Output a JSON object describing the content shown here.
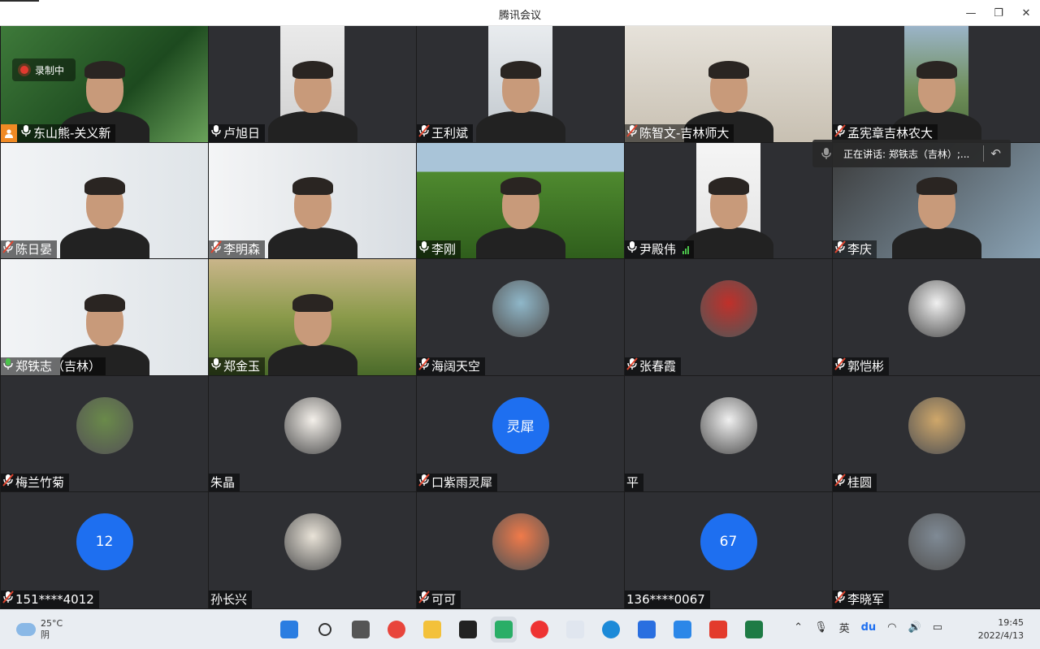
{
  "window": {
    "title": "腾讯会议",
    "controls": [
      "minimize",
      "restore",
      "close"
    ]
  },
  "recording": {
    "label": "录制中"
  },
  "speaking": {
    "text": "正在讲话: 郑铁志（吉林）;..."
  },
  "participants": [
    {
      "name": "东山熊-关义新",
      "mic": "on",
      "host": true,
      "media": "video"
    },
    {
      "name": "卢旭日",
      "mic": "on",
      "media": "video"
    },
    {
      "name": "王利斌",
      "mic": "muted",
      "media": "video"
    },
    {
      "name": "陈智文-吉林师大",
      "mic": "muted",
      "media": "video"
    },
    {
      "name": "孟宪章吉林农大",
      "mic": "muted",
      "media": "video"
    },
    {
      "name": "陈日晏",
      "mic": "muted",
      "media": "video"
    },
    {
      "name": "李明森",
      "mic": "muted",
      "media": "video"
    },
    {
      "name": "李刚",
      "mic": "on",
      "media": "video"
    },
    {
      "name": "尹殿伟",
      "mic": "on",
      "media": "video",
      "signal": true
    },
    {
      "name": "李庆",
      "mic": "muted",
      "media": "video"
    },
    {
      "name": "郑铁志（吉林）",
      "mic": "speaking",
      "media": "video"
    },
    {
      "name": "郑金玉",
      "mic": "on",
      "media": "video"
    },
    {
      "name": "海阔天空",
      "mic": "muted",
      "media": "avatar"
    },
    {
      "name": "张春霞",
      "mic": "muted",
      "media": "avatar"
    },
    {
      "name": "郭恺彬",
      "mic": "muted",
      "media": "avatar"
    },
    {
      "name": "梅兰竹菊",
      "mic": "muted",
      "media": "avatar"
    },
    {
      "name": "朱晶",
      "mic": "none",
      "media": "avatar"
    },
    {
      "name": "口紫雨灵犀",
      "mic": "muted",
      "media": "avatar-text",
      "avatar_text": "灵犀"
    },
    {
      "name": "平",
      "mic": "none",
      "media": "avatar"
    },
    {
      "name": "桂圆",
      "mic": "muted",
      "media": "avatar"
    },
    {
      "name": "151****4012",
      "mic": "muted",
      "media": "avatar-text",
      "avatar_text": "12"
    },
    {
      "name": "孙长兴",
      "mic": "none",
      "media": "avatar"
    },
    {
      "name": "可可",
      "mic": "muted",
      "media": "avatar"
    },
    {
      "name": "136****0067",
      "mic": "none",
      "media": "avatar-text",
      "avatar_text": "67"
    },
    {
      "name": "李晓军",
      "mic": "muted",
      "media": "avatar"
    }
  ],
  "taskbar": {
    "weather": {
      "temp": "25°C",
      "condition": "阴"
    },
    "apps": [
      "windows-start",
      "search",
      "task-view",
      "chrome",
      "file-explorer",
      "qq",
      "wechat",
      "app-dlp",
      "app-m",
      "edge",
      "app-blue",
      "app-cloud",
      "wps",
      "excel"
    ],
    "tray": {
      "lang": "英",
      "ime": "du"
    },
    "time": "19:45",
    "date": "2022/4/13"
  },
  "colors": {
    "muted": "#e0452f",
    "on": "#ffffff",
    "speaking": "#4bc24b",
    "avatar_blue": "#1e6ff0",
    "host": "#f08a24"
  }
}
